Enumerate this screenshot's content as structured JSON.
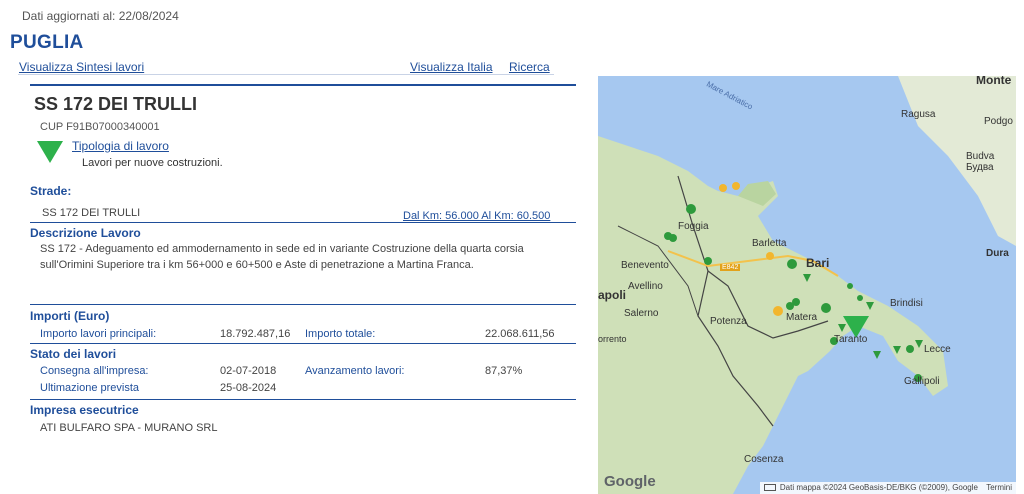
{
  "header": {
    "updated": "Dati aggiornati al: 22/08/2024",
    "region": "PUGLIA",
    "link_sintesi": "Visualizza Sintesi lavori",
    "link_italia": "Visualizza Italia",
    "link_ricerca": "Ricerca"
  },
  "work": {
    "title": "SS 172 DEI TRULLI",
    "cup": "CUP F91B07000340001",
    "tipologia_label": "Tipologia di lavoro",
    "tipologia_value": "Lavori per nuove costruzioni.",
    "icon": "green-down-triangle"
  },
  "strade": {
    "heading": "Strade:",
    "name": "SS 172 DEI TRULLI",
    "km": "Dal Km: 56.000 Al Km: 60.500"
  },
  "descrizione": {
    "heading": "Descrizione Lavoro",
    "text": "SS 172 - Adeguamento ed ammodernamento in sede ed in variante Costruzione della quarta corsia sull'Orimini Superiore tra i km 56+000 e 60+500 e Aste di penetrazione a Martina Franca."
  },
  "importi": {
    "heading": "Importi (Euro)",
    "principali_label": "Importo lavori principali:",
    "principali_value": "18.792.487,16",
    "totale_label": "Importo totale:",
    "totale_value": "22.068.611,56"
  },
  "stato": {
    "heading": "Stato dei lavori",
    "consegna_label": "Consegna all'impresa:",
    "consegna_value": "02-07-2018",
    "avanzamento_label": "Avanzamento lavori:",
    "avanzamento_value": "87,37%",
    "ultimazione_label": "Ultimazione prevista",
    "ultimazione_value": "25-08-2024"
  },
  "impresa": {
    "heading": "Impresa esecutrice",
    "name": "ATI BULFARO SPA - MURANO SRL"
  },
  "map": {
    "labels": {
      "montenegro": "Monte",
      "ragusa": "Ragusa",
      "budva": "Budva\nБудва",
      "durazzo": "Dura",
      "mare": "Mare Adriatico",
      "foggia": "Foggia",
      "barletta": "Barletta",
      "bari": "Bari",
      "benevento": "Benevento",
      "avellino": "Avellino",
      "napoli": "apoli",
      "salerno": "Salerno",
      "potenza": "Potenza",
      "matera": "Matera",
      "brindisi": "Brindisi",
      "taranto": "Taranto",
      "lecce": "Lecce",
      "gallipoli": "Gallipoli",
      "cosenza": "Cosenza",
      "sorrento": "orrento",
      "e842": "E842",
      "podgo": "Podgo"
    },
    "google": "Google",
    "attribution": "Dati mappa ©2024 GeoBasis-DE/BKG (©2009), Google",
    "terms": "Termini",
    "colors": {
      "sea": "#a6c8f0",
      "land": "#dfe8cf",
      "marker_green": "#2e9a3c",
      "marker_yellow": "#f2b62e"
    }
  }
}
